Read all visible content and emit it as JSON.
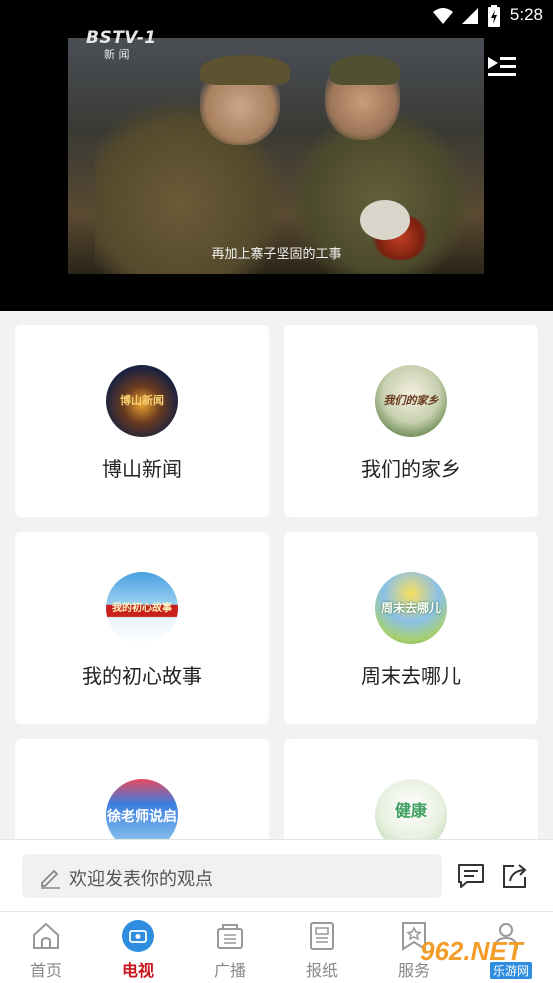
{
  "status_bar": {
    "time": "5:28"
  },
  "video": {
    "channel_logo": "BSTV-1",
    "channel_sub": "新 闻",
    "subtitle": "再加上寨子坚固的工事",
    "playlist_icon": "playlist-icon"
  },
  "cards": [
    {
      "title": "博山新闻",
      "icon_text": "博山新闻",
      "icon_colors": [
        "#2a3350",
        "#e0a040"
      ]
    },
    {
      "title": "我们的家乡",
      "icon_text": "我们的家乡",
      "icon_colors": [
        "#cfd8c0",
        "#8a6a50"
      ]
    },
    {
      "title": "我的初心故事",
      "icon_text": "我的初心故事",
      "icon_colors": [
        "#4aa0e0",
        "#c8201a"
      ]
    },
    {
      "title": "周末去哪儿",
      "icon_text": "周末去哪儿",
      "icon_colors": [
        "#8ac0e8",
        "#f0d040"
      ]
    },
    {
      "title": "",
      "icon_text": "徐老师说启",
      "icon_colors": [
        "#3a7ee0",
        "#e84a60"
      ]
    },
    {
      "title": "",
      "icon_text": "健康",
      "icon_colors": [
        "#e8f0e0",
        "#40a060"
      ]
    }
  ],
  "comment_bar": {
    "placeholder": "欢迎发表你的观点",
    "comments_icon": "comments-icon",
    "share_icon": "share-icon"
  },
  "bottom_nav": [
    {
      "label": "首页",
      "icon": "home-icon",
      "active": false
    },
    {
      "label": "电视",
      "icon": "tv-icon",
      "active": true
    },
    {
      "label": "广播",
      "icon": "radio-icon",
      "active": false
    },
    {
      "label": "报纸",
      "icon": "newspaper-icon",
      "active": false
    },
    {
      "label": "服务",
      "icon": "service-icon",
      "active": false
    },
    {
      "label": "我的",
      "icon": "user-icon",
      "active": false
    }
  ],
  "watermark": {
    "text": "962.NET",
    "sub": "乐游网"
  },
  "colors": {
    "accent": "#c5141b",
    "active_tab_icon": "#2f8de0"
  }
}
